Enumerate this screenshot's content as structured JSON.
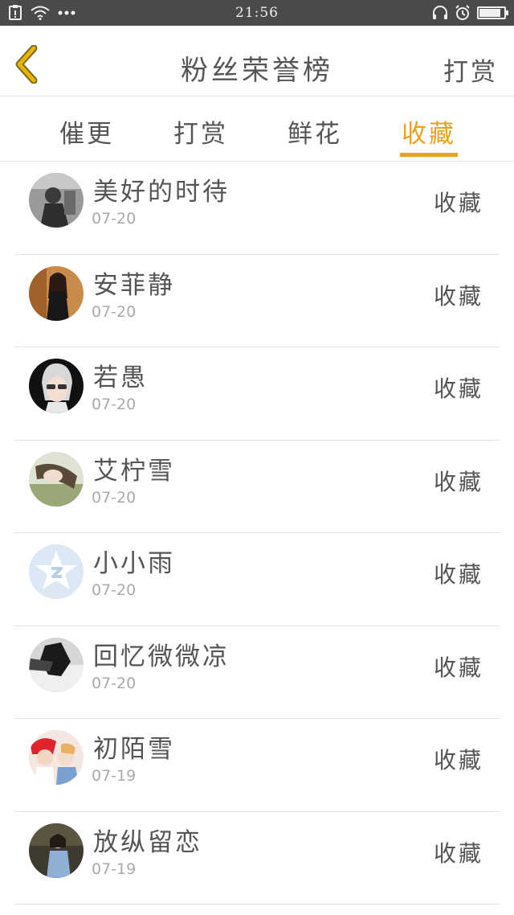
{
  "status_bar": {
    "time": "21:56",
    "left_icons": [
      "clipboard-icon",
      "wifi-icon",
      "more-dots-icon"
    ],
    "right_icons": [
      "headphones-icon",
      "alarm-icon",
      "battery-icon"
    ],
    "battery_level": 0.88
  },
  "header": {
    "title": "粉丝荣誉榜",
    "action_label": "打赏",
    "back_icon": "chevron-left-icon",
    "accent_color": "#e8b400"
  },
  "tabs": [
    {
      "label": "催更",
      "active": false
    },
    {
      "label": "打赏",
      "active": false
    },
    {
      "label": "鲜花",
      "active": false
    },
    {
      "label": "收藏",
      "active": true
    }
  ],
  "colors": {
    "active_tab": "#f0a020",
    "status_bar": "#4a4a4a",
    "text": "#555555",
    "date_text": "#aaaaaa"
  },
  "fans": [
    {
      "name": "美好的时待",
      "date": "07-20",
      "action": "收藏"
    },
    {
      "name": "安菲静",
      "date": "07-20",
      "action": "收藏"
    },
    {
      "name": "若愚",
      "date": "07-20",
      "action": "收藏"
    },
    {
      "name": "艾柠雪",
      "date": "07-20",
      "action": "收藏"
    },
    {
      "name": "小小雨",
      "date": "07-20",
      "action": "收藏"
    },
    {
      "name": "回忆微微凉",
      "date": "07-20",
      "action": "收藏"
    },
    {
      "name": "初陌雪",
      "date": "07-19",
      "action": "收藏"
    },
    {
      "name": "放纵留恋",
      "date": "07-19",
      "action": "收藏"
    }
  ]
}
